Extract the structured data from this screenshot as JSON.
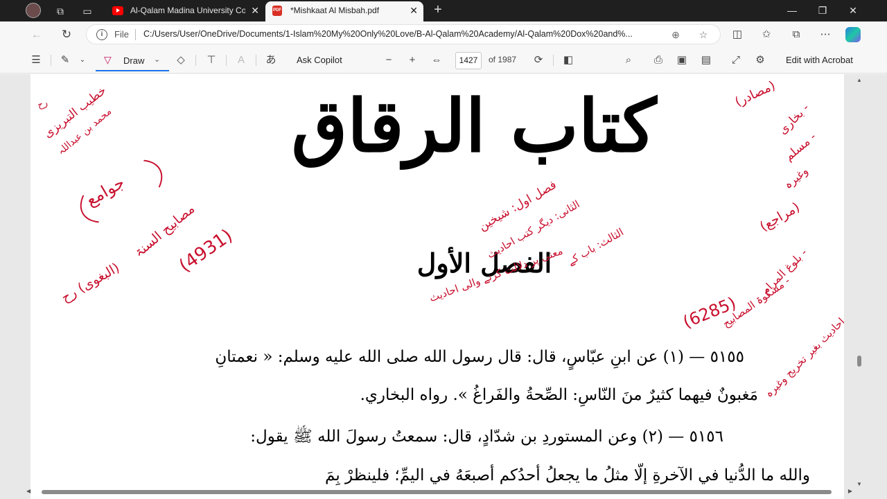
{
  "browser": {
    "tabs": [
      {
        "title": "Al-Qalam Madina University Cou",
        "active": false,
        "favicon": "youtube-icon"
      },
      {
        "title": "*Mishkaat Al Misbah.pdf",
        "active": true,
        "favicon": "pdf-icon"
      }
    ],
    "address": {
      "scheme": "File",
      "url": "C:/Users/User/OneDrive/Documents/1-Islam%20My%20Only%20Love/B-Al-Qalam%20Academy/Al-Qalam%20Dox%20and%..."
    }
  },
  "pdf_toolbar": {
    "draw_label": "Draw",
    "ask_copilot": "Ask Copilot",
    "current_page": "1427",
    "page_total": "of 1987",
    "edit_acrobat": "Edit with Acrobat"
  },
  "document": {
    "book_title": "كتاب الرقاق",
    "section_title": "الفصل الأول",
    "hadith_lines": [
      "٥١٥٥ — (١) عن ابنِ عبّاسٍ، قال: قال رسول الله صلى الله عليه وسلم: « نعمتانِ",
      "مَغبونٌ فيهما كثيرٌ منَ النّاسِ: الصِّحةُ والفَراغُ ». رواه البخاري.",
      "٥١٥٦ — (٢) وعن المستوردِ بن شدّادٍ، قال: سمعتُ رسولَ الله ﷺ يقول:",
      "والله ما الدُّنيا في الآخرةِ إلّا مثلُ ما يجعلُ أحدُكم أصبعَهُ في اليمِّ؛ فلينظرْ بِمَ"
    ]
  },
  "annotations": {
    "ink_color": "#c8102e",
    "left": {
      "author_line1": "خطیب التبریزی",
      "author_line2": "محمد بن عبداللہ",
      "rah": "رح",
      "jawami": "جوامع",
      "masabih": "مصابیح السنۃ",
      "masabih_count": "(4931)",
      "baghawi": "(البغوی) رح"
    },
    "center": {
      "fasl_awwal": "فصل اول: شیخین",
      "thani": "الثانی: دیگر کتب احادیث",
      "thalith": "الثالث: باب کے",
      "maani": "معنی پر دلالت کرنے والی احادیث"
    },
    "right": {
      "masadir": "(مصادر)",
      "bukhari": "- بخاری",
      "muslim": "- مسلم",
      "waghairah": "وغیرہ",
      "marajie": "(مراجع)",
      "bulugh": "- بلوغ المرام",
      "mishkat": "- مشکوۃ المصابیح",
      "mishkat_count": "(6285)",
      "ahadith": "احادیث بغیر تخریج وغیرہ"
    }
  }
}
